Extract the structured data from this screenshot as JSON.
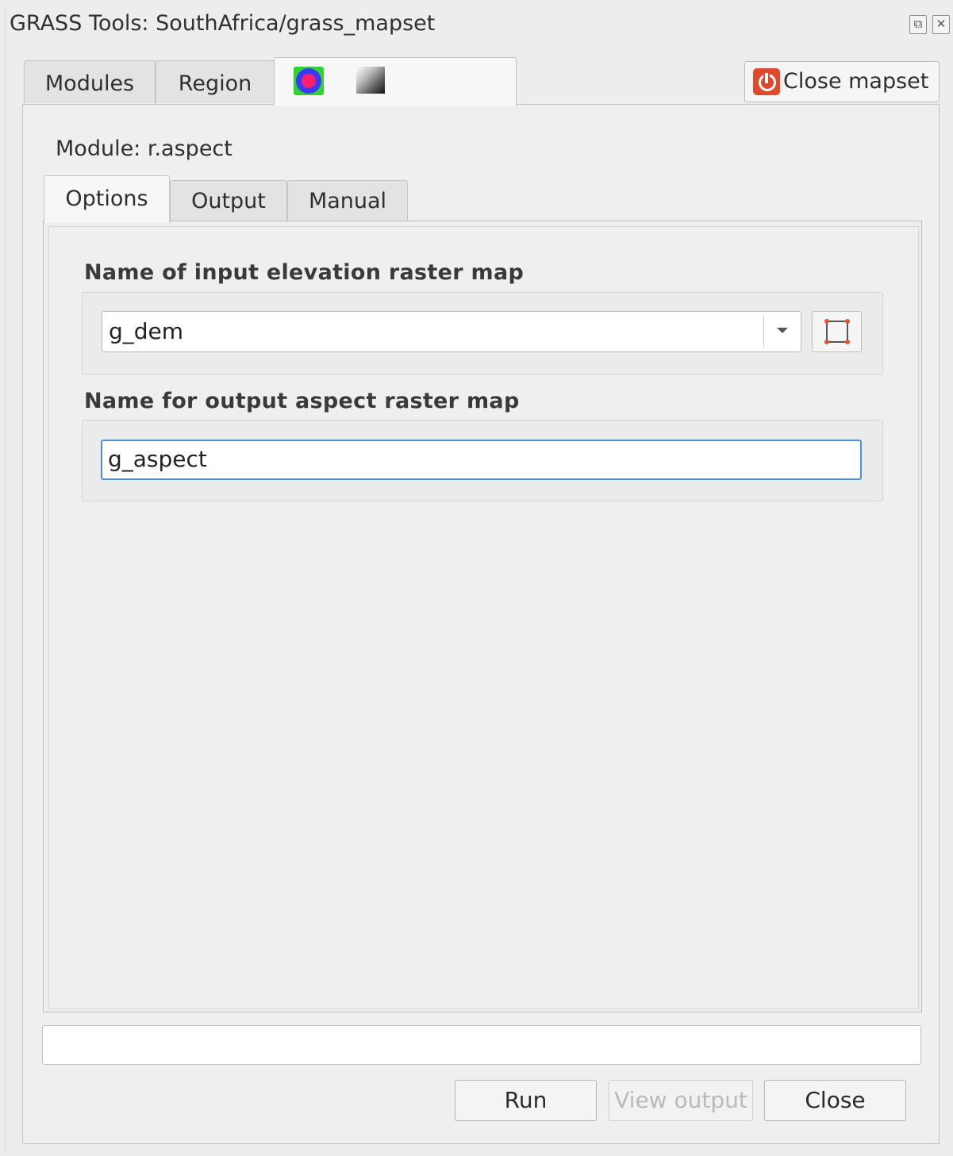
{
  "window": {
    "title": "GRASS Tools: SouthAfrica/grass_mapset",
    "float_icon": "float-icon",
    "close_icon": "close-icon"
  },
  "main_tabs": [
    {
      "label": "Modules"
    },
    {
      "label": "Region"
    },
    {
      "label": "",
      "icons": [
        "raster-color-icon",
        "raster-gradient-icon"
      ]
    }
  ],
  "close_mapset": {
    "label": "Close mapset",
    "icon": "power-icon"
  },
  "module": {
    "label": "Module: r.aspect"
  },
  "sub_tabs": [
    {
      "label": "Options"
    },
    {
      "label": "Output"
    },
    {
      "label": "Manual"
    }
  ],
  "fields": {
    "input": {
      "label": "Name of input elevation raster map",
      "value": "g_dem",
      "extent_icon": "select-extent-icon"
    },
    "output": {
      "label": "Name for output aspect raster map",
      "value": "g_aspect"
    }
  },
  "status": {
    "text": ""
  },
  "buttons": {
    "run": "Run",
    "view_output": "View output",
    "close": "Close"
  },
  "colors": {
    "accent_focus": "#4a90d9",
    "close_mapset_icon": "#e0492b"
  }
}
